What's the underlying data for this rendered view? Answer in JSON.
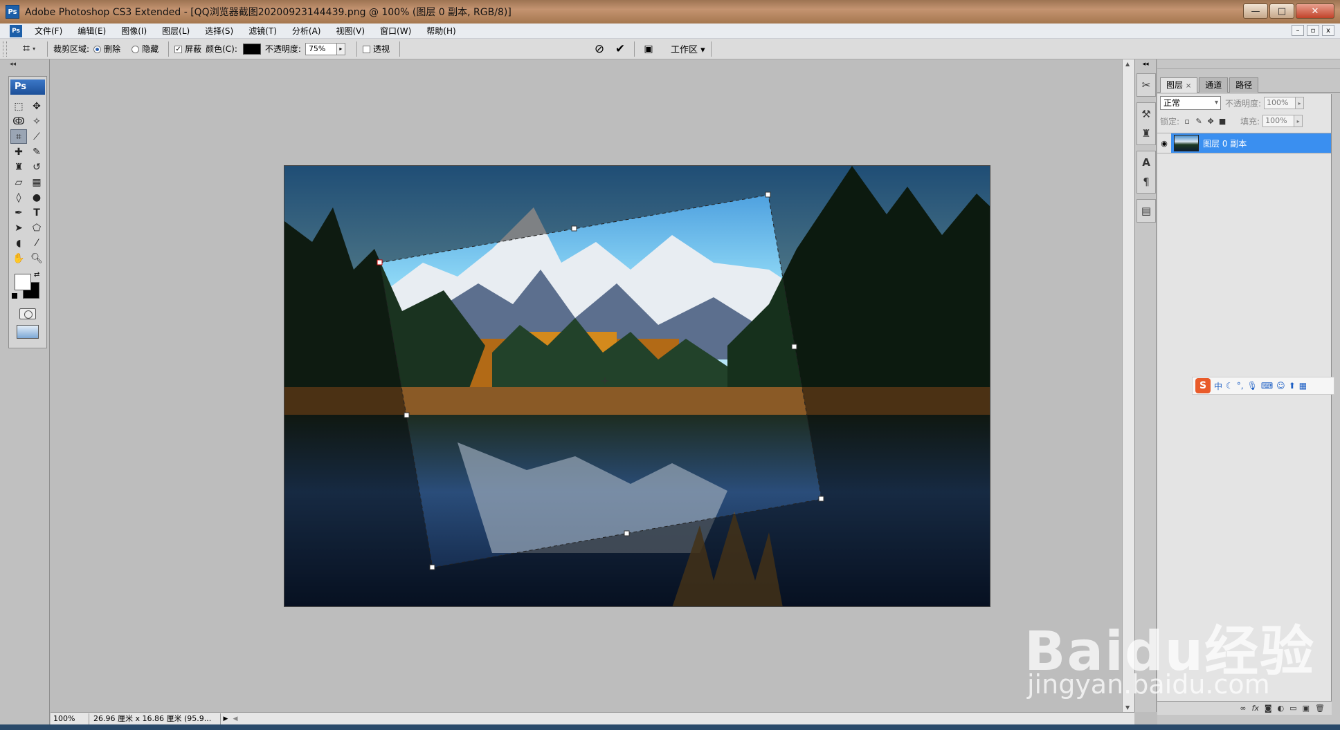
{
  "window": {
    "title": "Adobe Photoshop CS3 Extended - [QQ浏览器截图20200923144439.png @ 100% (图层 0 副本, RGB/8)]",
    "app_icon_label": "Ps",
    "minimize": "—",
    "maximize": "□",
    "close": "✕"
  },
  "menu": {
    "items": [
      "文件(F)",
      "编辑(E)",
      "图像(I)",
      "图层(L)",
      "选择(S)",
      "滤镜(T)",
      "分析(A)",
      "视图(V)",
      "窗口(W)",
      "帮助(H)"
    ],
    "doc_minimize": "–",
    "doc_restore": "▫",
    "doc_close": "x"
  },
  "options": {
    "crop_area_label": "裁剪区域:",
    "delete_label": "删除",
    "hide_label": "隐藏",
    "shield_label": "屏蔽",
    "color_label": "颜色(C):",
    "color_value": "#000000",
    "opacity_label": "不透明度:",
    "opacity_value": "75%",
    "perspective_label": "透视",
    "workspace_label": "工作区 ▾",
    "delete_selected": true,
    "shield_checked": true,
    "perspective_checked": false
  },
  "toolbox": {
    "logo": "Ps"
  },
  "status": {
    "zoom": "100%",
    "doc_info": "26.96 厘米 x 16.86 厘米 (95.9..."
  },
  "layers": {
    "tabs": [
      "图层",
      "通道",
      "路径"
    ],
    "tab_close": "×",
    "blend_mode": "正常",
    "opacity_label": "不透明度:",
    "opacity_value": "100%",
    "lock_label": "锁定:",
    "fill_label": "填充:",
    "fill_value": "100%",
    "layer_name": "图层 0 副本"
  },
  "ime": {
    "logo": "S",
    "lang": "中"
  },
  "watermark": {
    "main": "Baidu经验",
    "sub": "jingyan.baidu.com"
  },
  "colors": {
    "title_bar": "#c49370",
    "selected_layer": "#3a8ff0",
    "crop_shield_opacity": 0.75
  }
}
